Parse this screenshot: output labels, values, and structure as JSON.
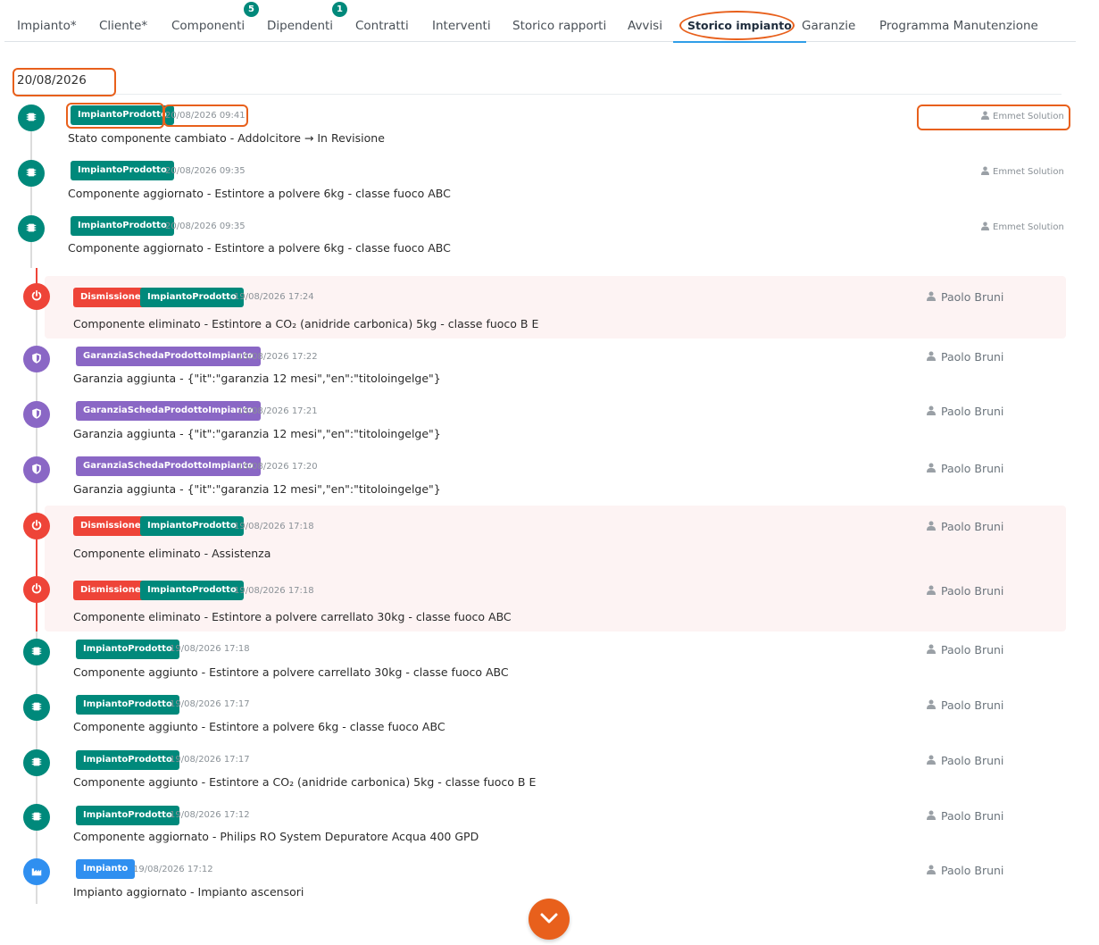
{
  "tabs": [
    {
      "label": "Impianto*"
    },
    {
      "label": "Cliente*"
    },
    {
      "label": "Componenti",
      "badge": "5"
    },
    {
      "label": "Dipendenti",
      "badge": "1"
    },
    {
      "label": "Contratti"
    },
    {
      "label": "Interventi"
    },
    {
      "label": "Storico rapporti"
    },
    {
      "label": "Avvisi"
    },
    {
      "label": "Storico impianto",
      "active": true
    },
    {
      "label": "Garanzie"
    },
    {
      "label": "Programma Manutenzione"
    }
  ],
  "date_heading": "20/08/2026",
  "events_top": [
    {
      "tag": "ImpiantoProdotto",
      "time": "20/08/2026 09:41",
      "message": "Stato componente cambiato - Addolcitore → In Revisione",
      "user": "Emmet Solution"
    },
    {
      "tag": "ImpiantoProdotto",
      "time": "20/08/2026 09:35",
      "message": "Componente aggiornato - Estintore a polvere 6kg - classe fuoco ABC",
      "user": "Emmet Solution"
    },
    {
      "tag": "ImpiantoProdotto",
      "time": "20/08/2026 09:35",
      "message": "Componente aggiornato - Estintore a polvere 6kg - classe fuoco ABC",
      "user": "Emmet Solution"
    }
  ],
  "events_bottom": [
    {
      "tags": [
        "Dismissione",
        "ImpiantoProdotto"
      ],
      "time": "19/08/2026 17:24",
      "message": "Componente eliminato - Estintore a CO₂ (anidride carbonica) 5kg - classe fuoco B E",
      "user": "Paolo Bruni"
    },
    {
      "tags": [
        "GaranziaSchedaProdottoImpianto"
      ],
      "time": "19/08/2026 17:22",
      "message": "Garanzia aggiunta - {\"it\":\"garanzia 12 mesi\",\"en\":\"titoloingelge\"}",
      "user": "Paolo Bruni"
    },
    {
      "tags": [
        "GaranziaSchedaProdottoImpianto"
      ],
      "time": "19/08/2026 17:21",
      "message": "Garanzia aggiunta - {\"it\":\"garanzia 12 mesi\",\"en\":\"titoloingelge\"}",
      "user": "Paolo Bruni"
    },
    {
      "tags": [
        "GaranziaSchedaProdottoImpianto"
      ],
      "time": "19/08/2026 17:20",
      "message": "Garanzia aggiunta - {\"it\":\"garanzia 12 mesi\",\"en\":\"titoloingelge\"}",
      "user": "Paolo Bruni"
    },
    {
      "tags": [
        "Dismissione",
        "ImpiantoProdotto"
      ],
      "time": "19/08/2026 17:18",
      "message": "Componente eliminato - Assistenza",
      "user": "Paolo Bruni"
    },
    {
      "tags": [
        "Dismissione",
        "ImpiantoProdotto"
      ],
      "time": "19/08/2026 17:18",
      "message": "Componente eliminato - Estintore a polvere carrellato 30kg - classe fuoco ABC",
      "user": "Paolo Bruni"
    },
    {
      "tags": [
        "ImpiantoProdotto"
      ],
      "time": "19/08/2026 17:18",
      "message": "Componente aggiunto - Estintore a polvere carrellato 30kg - classe fuoco ABC",
      "user": "Paolo Bruni"
    },
    {
      "tags": [
        "ImpiantoProdotto"
      ],
      "time": "19/08/2026 17:17",
      "message": "Componente aggiunto - Estintore a polvere 6kg - classe fuoco ABC",
      "user": "Paolo Bruni"
    },
    {
      "tags": [
        "ImpiantoProdotto"
      ],
      "time": "19/08/2026 17:17",
      "message": "Componente aggiunto - Estintore a CO₂ (anidride carbonica) 5kg - classe fuoco B E",
      "user": "Paolo Bruni"
    },
    {
      "tags": [
        "ImpiantoProdotto"
      ],
      "time": "19/08/2026 17:12",
      "message": "Componente aggiornato - Philips RO System Depuratore Acqua 400 GPD",
      "user": "Paolo Bruni"
    },
    {
      "tags": [
        "Impianto"
      ],
      "time": "19/08/2026 17:12",
      "message": "Impianto aggiornato - Impianto ascensori",
      "user": "Paolo Bruni"
    }
  ],
  "colors": {
    "accent_orange": "#e8601c",
    "teal": "#00897b",
    "red": "#ee4438",
    "purple": "#8a67c5",
    "blue": "#2f8ff0",
    "active_tab_underline": "#2f9ee8"
  },
  "icons": {
    "component": "chip-icon",
    "dismissal": "power-icon",
    "warranty": "shield-icon",
    "plant": "factory-icon",
    "user": "user-icon",
    "scroll": "chevron-down-icon"
  }
}
